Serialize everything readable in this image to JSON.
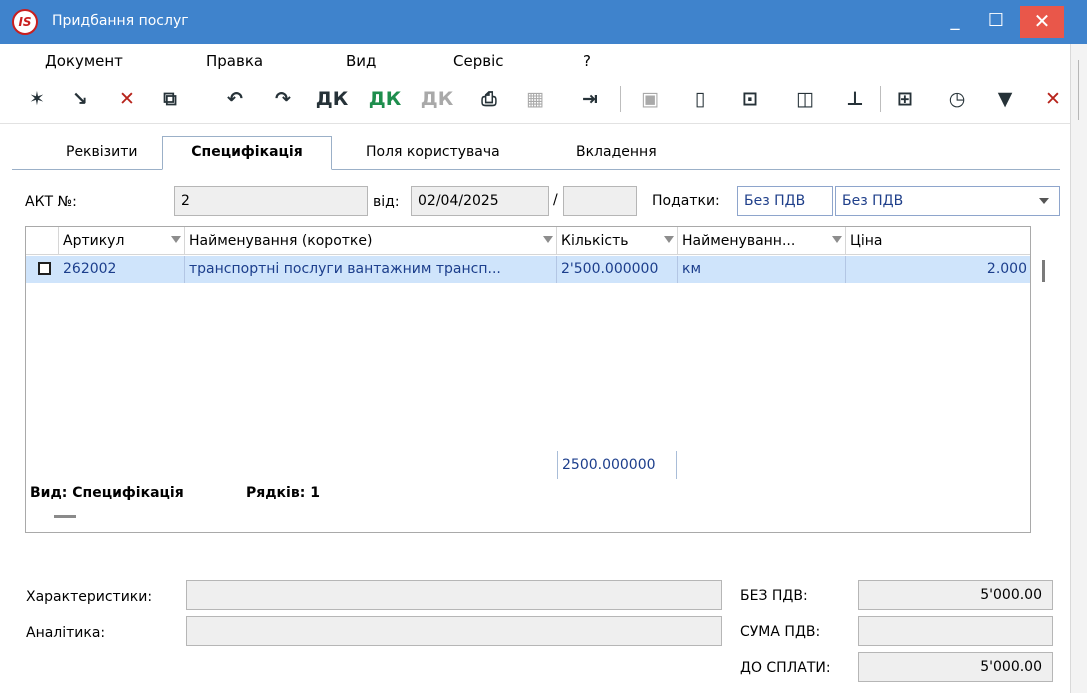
{
  "window": {
    "title": "Придбання послуг",
    "app_logo": "IS",
    "min": "_",
    "max": "☐",
    "close": "✕"
  },
  "menu": [
    "Документ",
    "Правка",
    "Вид",
    "Сервіс",
    "?"
  ],
  "tabs": [
    "Реквізити",
    "Специфікація",
    "Поля користувача",
    "Вкладення"
  ],
  "active_tab": "Специфікація",
  "header": {
    "act_label": "АКТ №:",
    "act_number": "2",
    "date_label": "від:",
    "date": "02/04/2025",
    "slash": "/",
    "suffix": "",
    "tax_label": "Податки:",
    "tax_value_1": "Без ПДВ",
    "tax_value_2": "Без ПДВ"
  },
  "grid": {
    "columns": [
      "Артикул",
      "Найменування (коротке)",
      "Кількість",
      "Найменуванн...",
      "Ціна"
    ],
    "rows": [
      {
        "article": "262002",
        "name": "транспортні послуги вантажним трансп...",
        "quantity": "2'500.000000",
        "unit": "км",
        "price": "2.000"
      }
    ],
    "total_quantity": "2500.000000",
    "view_label": "Вид: Специфікація",
    "rows_label": "Рядків: 1"
  },
  "footer": {
    "characteristics_label": "Характеристики:",
    "characteristics_value": "",
    "analytics_label": "Аналітика:",
    "analytics_value": "",
    "without_vat_label": "БЕЗ ПДВ:",
    "without_vat_value": "5'000.00",
    "vat_sum_label": "СУМА ПДВ:",
    "vat_sum_value": "",
    "to_pay_label": "ДО СПЛАТИ:",
    "to_pay_value": "5'000.00"
  },
  "toolbar_icons": [
    "new-doc-icon",
    "copy-doc-icon",
    "delete-doc-icon",
    "duplicate-icon",
    "undo-doc-icon",
    "redo-doc-icon",
    "debit-credit-icon",
    "debit-credit-green-icon",
    "debit-credit-disabled-icon",
    "print-icon",
    "excel-disabled-icon",
    "export-icon",
    "save-disabled-icon",
    "open-book-icon",
    "image-icon",
    "users-icon",
    "hierarchy-icon",
    "grid-icon",
    "clock-icon",
    "filter-icon",
    "clear-filter-icon"
  ]
}
